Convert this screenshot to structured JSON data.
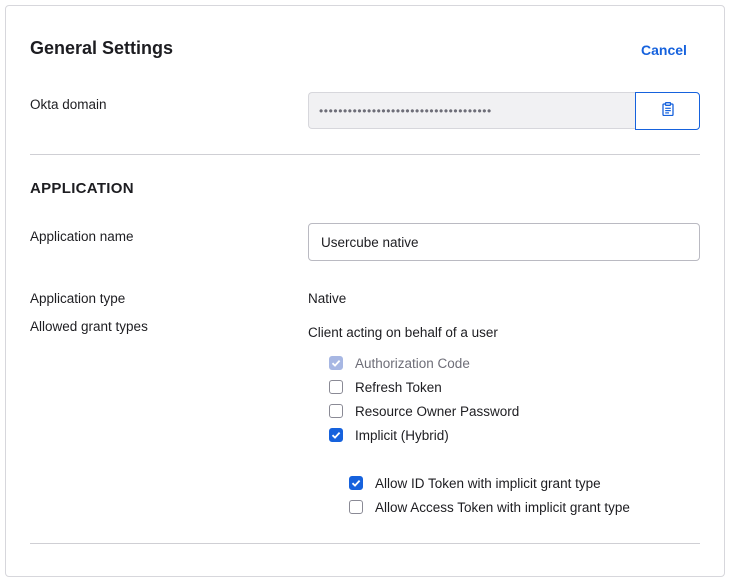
{
  "header": {
    "title": "General Settings",
    "cancel_label": "Cancel"
  },
  "okta_domain": {
    "label": "Okta domain",
    "masked_value": "••••••••••••••••••••••••••••••••••••",
    "copy_icon": "clipboard-icon"
  },
  "application": {
    "section_title": "APPLICATION",
    "name_label": "Application name",
    "name_value": "Usercube native",
    "type_label": "Application type",
    "type_value": "Native",
    "grant_label": "Allowed grant types",
    "grant_group_title": "Client acting on behalf of a user",
    "grants": [
      {
        "label": "Authorization Code",
        "checked": true,
        "disabled": true
      },
      {
        "label": "Refresh Token",
        "checked": false,
        "disabled": false
      },
      {
        "label": "Resource Owner Password",
        "checked": false,
        "disabled": false
      },
      {
        "label": "Implicit (Hybrid)",
        "checked": true,
        "disabled": false
      }
    ],
    "implicit_options": [
      {
        "label": "Allow ID Token with implicit grant type",
        "checked": true
      },
      {
        "label": "Allow Access Token with implicit grant type",
        "checked": false
      }
    ]
  },
  "colors": {
    "accent": "#1662dd",
    "disabled_check": "#a7b7e3",
    "border": "#d7d7dc"
  }
}
